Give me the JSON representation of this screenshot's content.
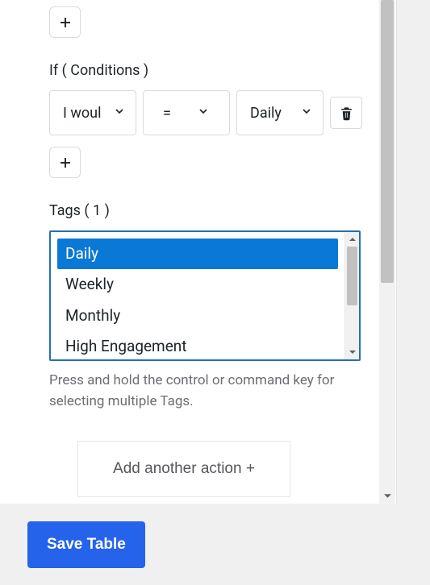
{
  "conditions": {
    "label": "If ( Conditions )",
    "rows": [
      {
        "column": "I woul",
        "operator": "=",
        "value": "Daily"
      }
    ]
  },
  "tags": {
    "label": "Tags ( 1 )",
    "options": [
      "Daily",
      "Weekly",
      "Monthly",
      "High Engagement"
    ],
    "selected_index": 0,
    "hint": "Press and hold the control or command key for selecting multiple Tags."
  },
  "add_action_label": "Add another action +",
  "save_label": "Save Table"
}
